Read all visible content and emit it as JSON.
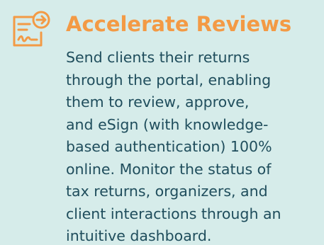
{
  "feature": {
    "title": "Accelerate Reviews",
    "icon": "document-arrow-icon",
    "accent_color": "#f39a45",
    "text_color": "#1f4d5c",
    "background_color": "#d6ecea",
    "description_lines": [
      "Send clients their returns",
      "through the portal, enabling",
      "them to review, approve,",
      "and eSign (with knowledge-",
      "based authentication) 100%",
      "online. Monitor the status of",
      "tax returns, organizers, and",
      "client interactions through an",
      "intuitive dashboard."
    ]
  }
}
